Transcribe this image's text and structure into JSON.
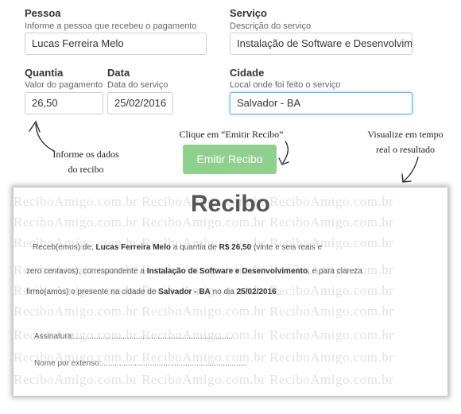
{
  "form": {
    "pessoa": {
      "label": "Pessoa",
      "help": "Informe a pessoa que recebeu o pagamento",
      "value": "Lucas Ferreira Melo"
    },
    "servico": {
      "label": "Serviço",
      "help": "Descrição do serviço",
      "value": "Instalação de Software e Desenvolvimento"
    },
    "quantia": {
      "label": "Quantia",
      "help": "Valor do pagamento",
      "value": "26,50"
    },
    "data": {
      "label": "Data",
      "help": "Data do serviço",
      "value": "25/02/2016"
    },
    "cidade": {
      "label": "Cidade",
      "help": "Local onde foi feito o serviço",
      "value": "Salvador - BA"
    }
  },
  "hints": {
    "left": "Informe os dados do recibo",
    "center": "Clique em “Emitir Recibo”",
    "right": "Visualize em tempo real o resultado"
  },
  "button": {
    "label": "Emitir Recibo"
  },
  "receipt": {
    "watermark": "ReciboAmigo.com.br",
    "title": "Recibo",
    "text_1": "Receb(emos) de,",
    "payer": "Lucas Ferreira Melo",
    "text_2": "a quantia de",
    "amount": "R$ 26,50",
    "amount_words": "(vinte e seis reais e",
    "text_3": "zero centavos), correspondente a",
    "service": "Instalação de Software e Desenvolvimento",
    "text_4": ", e para clareza",
    "text_5": "firmo(amos) o presente na cidade de",
    "city": "Salvador - BA",
    "text_6": "no dia",
    "date": "25/02/2016",
    "signature_label": "Assinatura:",
    "name_label": "Nome por extenso:"
  },
  "colors": {
    "button": "#8fd08f",
    "focus": "#66afe9"
  },
  "icons": [
    "arrow-up-left-icon",
    "arrow-down-icon",
    "arrow-down-left-icon"
  ]
}
